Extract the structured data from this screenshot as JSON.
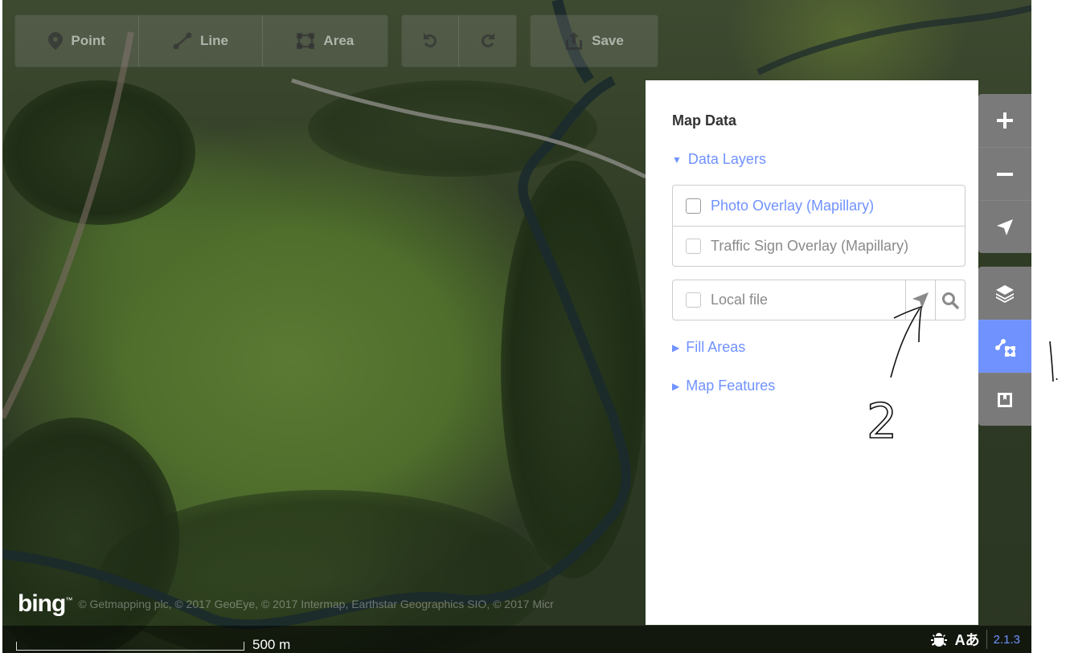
{
  "toolbar": {
    "point_label": "Point",
    "line_label": "Line",
    "area_label": "Area",
    "save_label": "Save"
  },
  "map_data_pane": {
    "title": "Map Data",
    "data_layers_label": "Data Layers",
    "layers": [
      {
        "label": "Photo Overlay (Mapillary)",
        "checked": false,
        "enabled": true
      },
      {
        "label": "Traffic Sign Overlay (Mapillary)",
        "checked": false,
        "enabled": false
      }
    ],
    "local_file_label": "Local file",
    "fill_areas_label": "Fill Areas",
    "map_features_label": "Map Features"
  },
  "controls": {
    "zoom_in": "plus-icon",
    "zoom_out": "minus-icon",
    "geolocate": "location-arrow-icon",
    "background": "layers-icon",
    "map_data": "map-data-icon",
    "issues": "bookmark-icon"
  },
  "attribution": {
    "logo_text": "bing",
    "text": "© Getmapping plc, © 2017 GeoEye, © 2017 Intermap, Earthstar Geographics SIO, © 2017 Micr"
  },
  "footer": {
    "scale_label": "500 m",
    "lang_label": "Aあ",
    "version": "2.1.3"
  },
  "annotations": {
    "mark_one": "1",
    "mark_two": "2"
  },
  "colors": {
    "accent": "#7092ff",
    "control_bg": "#7a7a7a"
  }
}
